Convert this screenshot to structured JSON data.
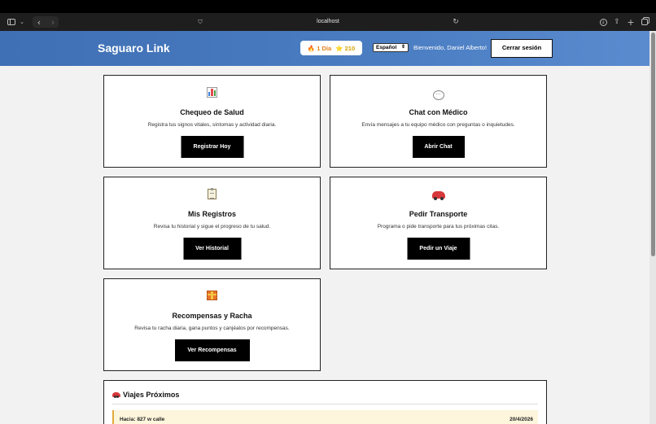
{
  "browser": {
    "url": "localhost"
  },
  "header": {
    "brand": "Saguaro Link",
    "streak": "🔥 1 Día",
    "points": "⭐ 210",
    "language": "Español",
    "welcome": "Bienvenido, Daniel Alberto!",
    "logout_label": "Cerrar sesión",
    "colors": {
      "header_bg": "#4a7dc2",
      "streak": "#e8831a",
      "points": "#d4a400"
    }
  },
  "cards": [
    {
      "icon": "bar-chart-icon",
      "title": "Chequeo de Salud",
      "description": "Registra tus signos vitales, síntomas y actividad diaria.",
      "button": "Registrar Hoy"
    },
    {
      "icon": "speech-bubble-icon",
      "title": "Chat con Médico",
      "description": "Envía mensajes a tu equipo médico con preguntas o inquietudes.",
      "button": "Abrir Chat"
    },
    {
      "icon": "clipboard-icon",
      "title": "Mis Registros",
      "description": "Revisa tu historial y sigue el progreso de tu salud.",
      "button": "Ver Historial"
    },
    {
      "icon": "car-icon",
      "title": "Pedir Transporte",
      "description": "Programa o pide transporte para tus próximas citas.",
      "button": "Pedir un Viaje"
    },
    {
      "icon": "gift-icon",
      "title": "Recompensas y Racha",
      "description": "Revisa tu racha diaria, gana puntos y canjéalos por recompensas.",
      "button": "Ver Recompensas"
    }
  ],
  "trips": {
    "title": "Viajes Próximos",
    "items": [
      {
        "destination": "Hacia: 827 w calle",
        "date": "20/4/2026"
      }
    ]
  }
}
